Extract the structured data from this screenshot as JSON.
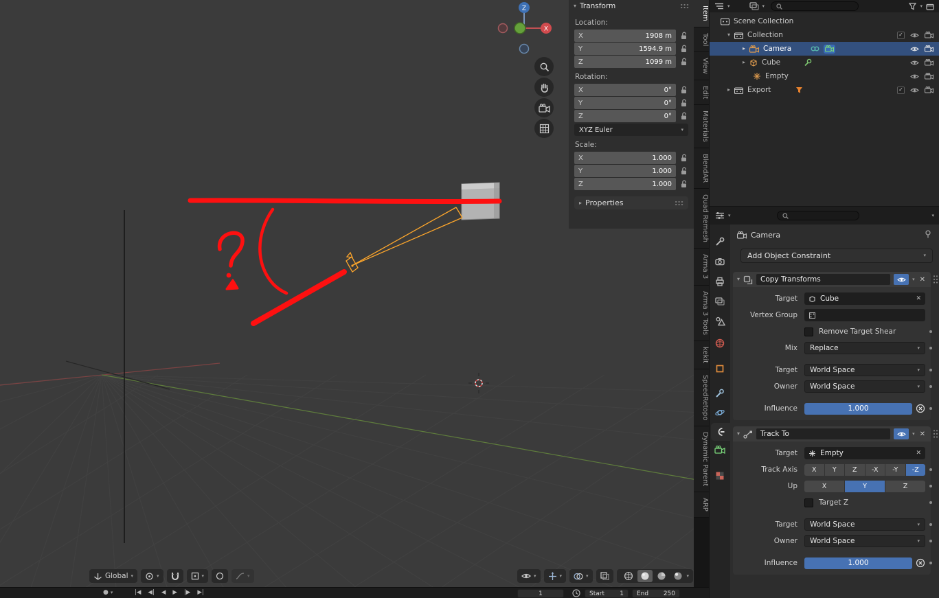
{
  "viewport": {
    "gizmo": {
      "z_label": "Z",
      "x_label": "X"
    },
    "toolbar": {
      "orientation": "Global"
    }
  },
  "timeline": {
    "current_frame": "1",
    "start_label": "Start",
    "start_value": "1",
    "end_label": "End",
    "end_value": "250"
  },
  "npanel": {
    "title": "Transform",
    "location_label": "Location:",
    "rotation_label": "Rotation:",
    "scale_label": "Scale:",
    "properties_label": "Properties",
    "rotation_mode": "XYZ Euler",
    "axis": [
      "X",
      "Y",
      "Z"
    ],
    "location": [
      "1908 m",
      "1594.9 m",
      "1099 m"
    ],
    "rotation": [
      "0°",
      "0°",
      "0°"
    ],
    "scale": [
      "1.000",
      "1.000",
      "1.000"
    ]
  },
  "sidebar_tabs": {
    "active": "Item",
    "items": [
      "Item",
      "Tool",
      "View",
      "Edit",
      "Materials",
      "BlendAR",
      "Quad Remesh",
      "Arma 3",
      "Arma 3 Tools",
      "kekit",
      "SpeedRetopo",
      "Dynamic Parent",
      "ARP"
    ]
  },
  "outliner": {
    "scene_collection": "Scene Collection",
    "collection": "Collection",
    "camera": "Camera",
    "cube": "Cube",
    "empty": "Empty",
    "export": "Export"
  },
  "properties": {
    "breadcrumb": "Camera",
    "add_button": "Add Object Constraint",
    "constraints": [
      {
        "name": "Copy Transforms",
        "target_label": "Target",
        "target_value": "Cube",
        "vertex_group_label": "Vertex Group",
        "remove_target_shear_label": "Remove Target Shear",
        "mix_label": "Mix",
        "mix_value": "Replace",
        "target_space_label": "Target",
        "target_space_value": "World Space",
        "owner_space_label": "Owner",
        "owner_space_value": "World Space",
        "influence_label": "Influence",
        "influence_value": "1.000"
      },
      {
        "name": "Track To",
        "target_label": "Target",
        "target_value": "Empty",
        "track_axis_label": "Track Axis",
        "track_axis_options": [
          "X",
          "Y",
          "Z",
          "-X",
          "-Y",
          "-Z"
        ],
        "track_axis_active": "-Z",
        "up_label": "Up",
        "up_options": [
          "X",
          "Y",
          "Z"
        ],
        "up_active": "Y",
        "target_z_label": "Target Z",
        "target_space_label": "Target",
        "target_space_value": "World Space",
        "owner_space_label": "Owner",
        "owner_space_value": "World Space",
        "influence_label": "Influence",
        "influence_value": "1.000"
      }
    ]
  }
}
